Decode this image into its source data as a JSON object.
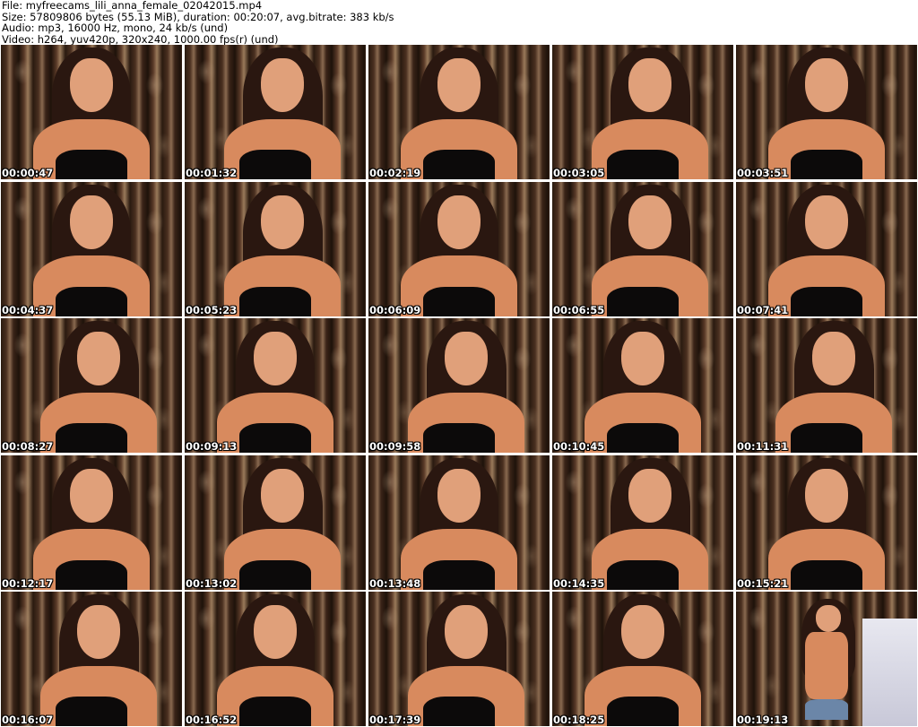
{
  "header": {
    "file_line": "File: myfreecams_lili_anna_female_02042015.mp4",
    "size_line": "Size: 57809806 bytes (55.13 MiB), duration: 00:20:07, avg.bitrate: 383 kb/s",
    "audio_line": "Audio: mp3, 16000 Hz, mono, 24 kb/s (und)",
    "video_line": "Video: h264, yuv420p, 320x240, 1000.00 fps(r) (und)"
  },
  "thumbnails": [
    {
      "timestamp": "00:00:47"
    },
    {
      "timestamp": "00:01:32"
    },
    {
      "timestamp": "00:02:19"
    },
    {
      "timestamp": "00:03:05"
    },
    {
      "timestamp": "00:03:51"
    },
    {
      "timestamp": "00:04:37"
    },
    {
      "timestamp": "00:05:23"
    },
    {
      "timestamp": "00:06:09"
    },
    {
      "timestamp": "00:06:55"
    },
    {
      "timestamp": "00:07:41"
    },
    {
      "timestamp": "00:08:27"
    },
    {
      "timestamp": "00:09:13"
    },
    {
      "timestamp": "00:09:58"
    },
    {
      "timestamp": "00:10:45"
    },
    {
      "timestamp": "00:11:31"
    },
    {
      "timestamp": "00:12:17"
    },
    {
      "timestamp": "00:13:02"
    },
    {
      "timestamp": "00:13:48"
    },
    {
      "timestamp": "00:14:35"
    },
    {
      "timestamp": "00:15:21"
    },
    {
      "timestamp": "00:16:07"
    },
    {
      "timestamp": "00:16:52"
    },
    {
      "timestamp": "00:17:39"
    },
    {
      "timestamp": "00:18:25"
    },
    {
      "timestamp": "00:19:13"
    }
  ]
}
